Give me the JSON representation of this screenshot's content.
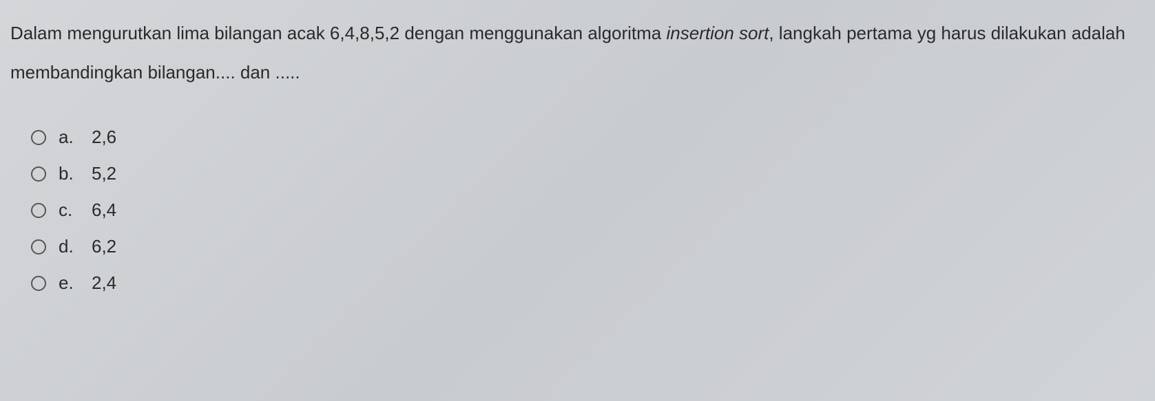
{
  "question": {
    "text_part1": "Dalam mengurutkan lima bilangan acak 6,4,8,5,2 dengan menggunakan algoritma ",
    "text_italic": "insertion sort",
    "text_part2": ", langkah pertama yg harus dilakukan adalah membandingkan bilangan.... dan ....."
  },
  "options": [
    {
      "letter": "a.",
      "value": "2,6"
    },
    {
      "letter": "b.",
      "value": "5,2"
    },
    {
      "letter": "c.",
      "value": "6,4"
    },
    {
      "letter": "d.",
      "value": "6,2"
    },
    {
      "letter": "e.",
      "value": "2,4"
    }
  ]
}
